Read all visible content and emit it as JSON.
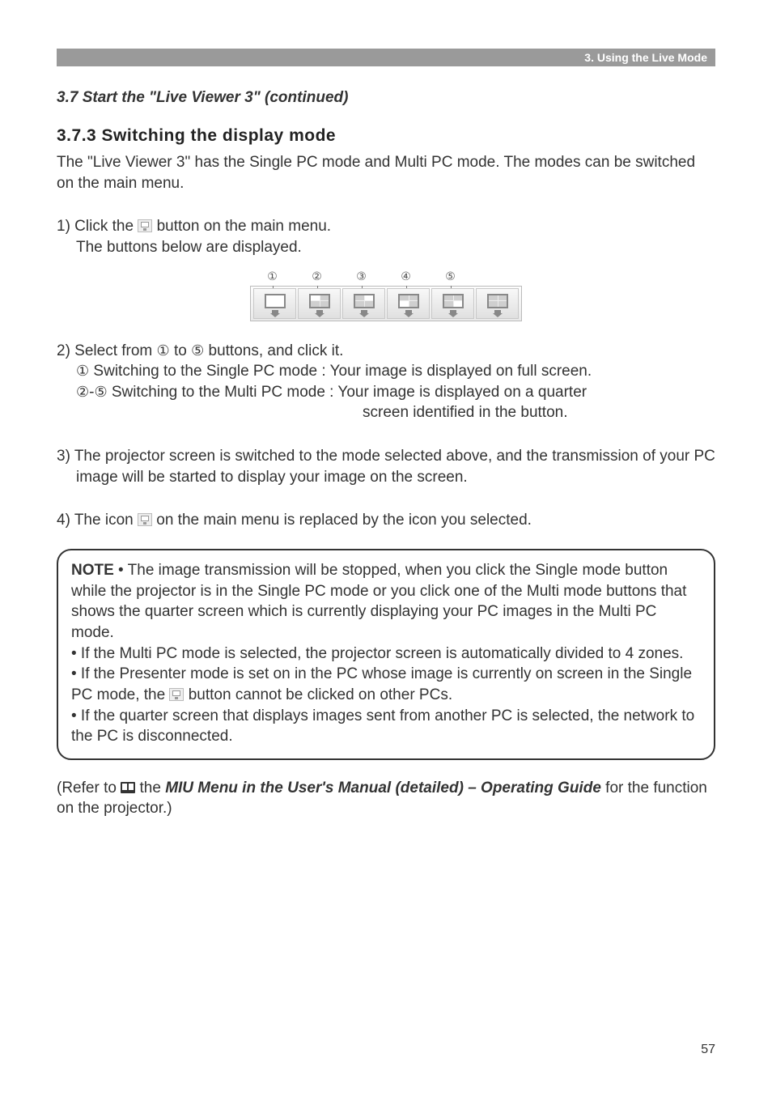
{
  "header": {
    "chapter": "3. Using the Live Mode"
  },
  "section": {
    "continued_title": "3.7 Start the \"Live Viewer 3\" (continued)",
    "subheading": "3.7.3 Switching the display mode",
    "intro": "The \"Live Viewer 3\" has the Single PC mode and Multi PC mode. The modes can be switched on the main menu.",
    "step1a": "1) Click the ",
    "step1b": " button on the main menu.",
    "step1c": "The buttons below are displayed.",
    "toolbar_numbers": [
      "①",
      "②",
      "③",
      "④",
      "⑤"
    ],
    "step2a": "2) Select from ",
    "step2b": " to ",
    "step2c": " buttons, and click it.",
    "step2_line1_num": "①",
    "step2_line1": " Switching to the Single PC mode : Your image is displayed on full screen.",
    "step2_line2_num_a": "②",
    "step2_line2_dash": "-",
    "step2_line2_num_b": "⑤",
    "step2_line2": " Switching to the Multi PC mode : Your image is displayed on a quarter",
    "step2_line3": "screen identified in the button.",
    "step3": "3) The projector screen is switched to the mode selected above, and the transmission of your PC image will be started to display your image on the screen.",
    "step4a": "4) The icon ",
    "step4b": " on the main menu is replaced by the icon you selected.",
    "num1": "①",
    "num5": "⑤"
  },
  "note": {
    "label": "NOTE",
    "bullet1": " • The image transmission will be stopped, when you click the Single mode button while the projector is in the Single PC mode or you click one of the Multi mode buttons that shows the quarter screen which is currently displaying your PC images in the Multi PC mode.",
    "bullet2": "• If the Multi PC mode is selected, the projector screen is automatically divided to 4 zones.",
    "bullet3a": "• If the Presenter mode is set on in the PC whose image is currently on screen in the Single PC mode, the ",
    "bullet3b": " button cannot be clicked on other PCs.",
    "bullet4": "• If the quarter screen that displays images sent from another PC is selected, the network to the PC is disconnected."
  },
  "reference": {
    "prefix": "(Refer to ",
    "link": " the ",
    "title": "MIU Menu in the User's Manual (detailed) – Operating Guide",
    "suffix": " for the function on the projector.)"
  },
  "page_number": "57"
}
